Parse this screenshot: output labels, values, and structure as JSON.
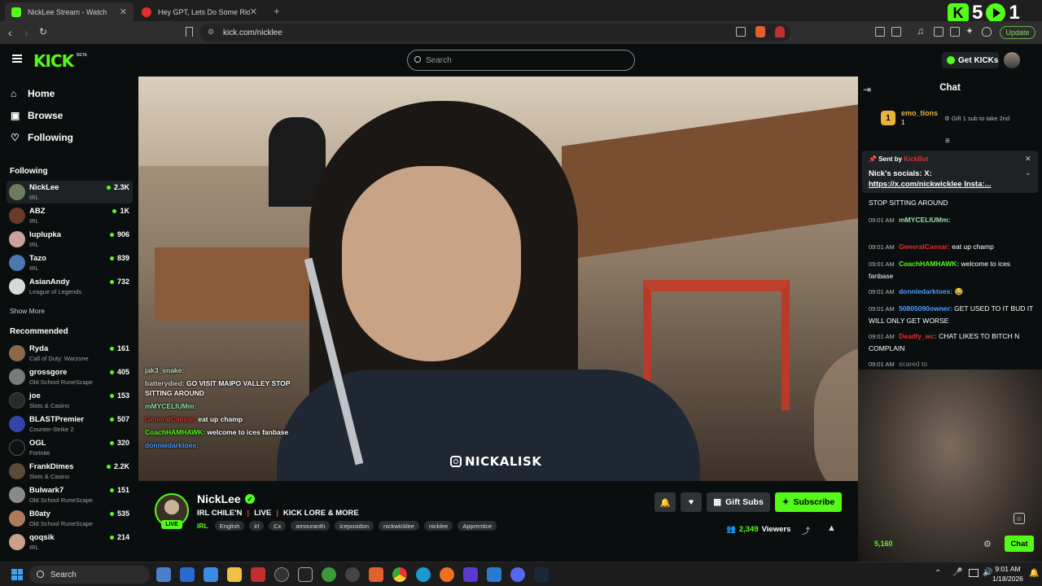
{
  "browser": {
    "tabs": [
      {
        "title": "NickLee Stream - Watch Live",
        "favicon_color": "#53fc18",
        "active": true
      },
      {
        "title": "Hey GPT, Lets Do Some Riddles - Yo",
        "favicon_color": "#e0312e",
        "active": false
      }
    ],
    "url": "kick.com/nicklee",
    "update_label": "Update",
    "overlay_numbers": [
      "5",
      "1"
    ]
  },
  "header": {
    "logo": "KICK",
    "logo_badge": "BETA",
    "search_placeholder": "Search",
    "get_kicks_label": "Get KICKs"
  },
  "sidebar": {
    "main_links": [
      {
        "label": "Home",
        "icon": "home-icon"
      },
      {
        "label": "Browse",
        "icon": "browse-icon"
      },
      {
        "label": "Following",
        "icon": "heart-icon"
      }
    ],
    "following_title": "Following",
    "following": [
      {
        "name": "NickLee",
        "category": "IRL",
        "viewers": "2.3K",
        "avatar_color": "#6b7d5a"
      },
      {
        "name": "ABZ",
        "category": "IRL",
        "viewers": "1K",
        "avatar_color": "#6a3a2a"
      },
      {
        "name": "luplupka",
        "category": "IRL",
        "viewers": "906",
        "avatar_color": "#c9a39b"
      },
      {
        "name": "Tazo",
        "category": "IRL",
        "viewers": "839",
        "avatar_color": "#4a78b0"
      },
      {
        "name": "AsianAndy",
        "category": "League of Legends",
        "viewers": "732",
        "avatar_color": "#d9d9d9"
      }
    ],
    "show_more_label": "Show More",
    "recommended_title": "Recommended",
    "recommended": [
      {
        "name": "Ryda",
        "category": "Call of Duty: Warzone",
        "viewers": "161",
        "avatar_color": "#8a6a4a"
      },
      {
        "name": "grossgore",
        "category": "Old School RuneScape",
        "viewers": "405",
        "avatar_color": "#7a7a7a"
      },
      {
        "name": "joe",
        "category": "Slots & Casino",
        "viewers": "153",
        "avatar_color": "#2a2a2a"
      },
      {
        "name": "BLASTPremier",
        "category": "Counter-Strike 2",
        "viewers": "507",
        "avatar_color": "#3344aa"
      },
      {
        "name": "OGL",
        "category": "Fortnite",
        "viewers": "320",
        "avatar_color": "#111111"
      },
      {
        "name": "FrankDimes",
        "category": "Slots & Casino",
        "viewers": "2.2K",
        "avatar_color": "#5a4a3a"
      },
      {
        "name": "Bulwark7",
        "category": "Old School RuneScape",
        "viewers": "151",
        "avatar_color": "#8a8a8a"
      },
      {
        "name": "B0aty",
        "category": "Old School RuneScape",
        "viewers": "535",
        "avatar_color": "#b07a5a"
      },
      {
        "name": "qoqsik",
        "category": "IRL",
        "viewers": "214",
        "avatar_color": "#caa08a"
      }
    ]
  },
  "video": {
    "caption": "NICKALISK",
    "overlay_chat": [
      {
        "user": "jak3_snake:",
        "text": ""
      },
      {
        "user": "batterydied:",
        "text": "GO VISIT MAIPO VALLEY STOP"
      },
      {
        "user": "",
        "text": "SITTING AROUND"
      },
      {
        "user": "mMYCELIUMm:",
        "text": ""
      },
      {
        "user": "GeneralCaesar:",
        "text": "eat up champ"
      },
      {
        "user": "CoachHAMHAWK:",
        "text": "welcome to ices fanbase"
      },
      {
        "user": "donniedarktoes:",
        "text": ""
      }
    ]
  },
  "stream": {
    "streamer": "NickLee",
    "live_label": "LIVE",
    "title_parts": [
      "IRL CHILE'N",
      "LIVE",
      "KICK LORE & MORE"
    ],
    "category": "IRL",
    "tags": [
      "English",
      "irl",
      "Cx",
      "amouranth",
      "iceposidon",
      "nickwicklee",
      "nicklee",
      "Apprentice"
    ],
    "gift_subs_label": "Gift Subs",
    "subscribe_label": "Subscribe",
    "viewers": "2,349",
    "viewers_label": "Viewers"
  },
  "chat": {
    "title": "Chat",
    "gift_leader": {
      "rank": "1",
      "user": "emo_tions",
      "count": "1"
    },
    "gift_hint": "Gift 1 sub to take 2nd",
    "pinned": {
      "sent_by_label": "Sent by",
      "bot": "KickBot",
      "message": "Nick's socials: X:",
      "link": "https://x.com/nickwicklee Insta:..."
    },
    "messages": [
      {
        "time": "",
        "user": "",
        "color": "#ffffff",
        "text": "STOP SITTING AROUND"
      },
      {
        "time": "09:01 AM",
        "user": "mMYCELIUMm:",
        "color": "#8fe0a8",
        "text": ""
      },
      {
        "time": "09:01 AM",
        "user": "GeneralCaesar:",
        "color": "#e0312e",
        "text": "eat up champ"
      },
      {
        "time": "09:01 AM",
        "user": "CoachHAMHAWK:",
        "color": "#53fc18",
        "text": "welcome to ices fanbase"
      },
      {
        "time": "09:01 AM",
        "user": "donniedarktoes:",
        "color": "#4a9eff",
        "text": "😂"
      },
      {
        "time": "09:01 AM",
        "user": "50805090owner:",
        "color": "#4a9eff",
        "text": "GET USED TO IT BUD IT WILL ONLY GET WORSE"
      },
      {
        "time": "09:01 AM",
        "user": "Deadly_wc:",
        "color": "#e0312e",
        "text": "CHAT LIKES TO BITCH N COMPLAIN"
      },
      {
        "time": "09:01 AM",
        "user": "",
        "color": "#888888",
        "text": "scared to"
      }
    ],
    "points": "5,160",
    "send_label": "Chat"
  },
  "taskbar": {
    "search_label": "Search",
    "time": "9:01 AM",
    "date": "1/18/2026"
  },
  "colors": {
    "brand": "#53fc18",
    "background": "#0b0e0f",
    "panel": "#1e2225"
  }
}
